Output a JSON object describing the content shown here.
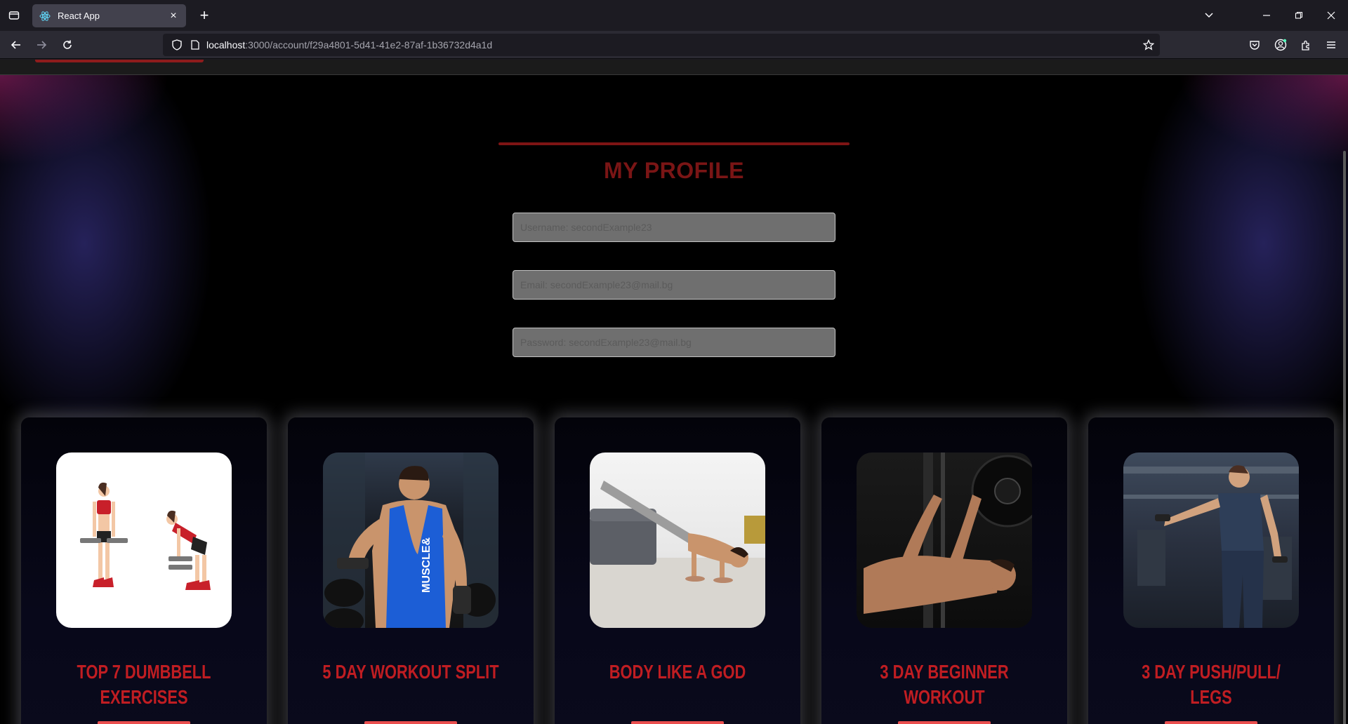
{
  "browser": {
    "tab_title": "React App",
    "url_host": "localhost",
    "url_rest": ":3000/account/f29a4801-5d41-41e2-87af-1b36732d4a1d"
  },
  "profile": {
    "title": "MY PROFILE",
    "username_placeholder": "Username: secondExample23",
    "email_placeholder": "Email: secondExample23@mail.bg",
    "password_placeholder": "Password: secondExample23@mail.bg"
  },
  "cards": [
    {
      "title": "TOP 7 DUMBBELL EXERCISES",
      "image": "dumbbell-exercise-illustration"
    },
    {
      "title": "5 DAY WORKOUT SPLIT",
      "image": "bicep-curl-photo"
    },
    {
      "title": "BODY LIKE A GOD",
      "image": "push-up-photo"
    },
    {
      "title": "3 DAY BEGINNER WORKOUT",
      "image": "bench-press-photo"
    },
    {
      "title": "3 DAY PUSH/PULL/ LEGS",
      "image": "lateral-raise-photo"
    }
  ],
  "colors": {
    "accent_red": "#c01d22",
    "button_red": "#e94e4e",
    "title_dark_red": "#7a1515"
  }
}
